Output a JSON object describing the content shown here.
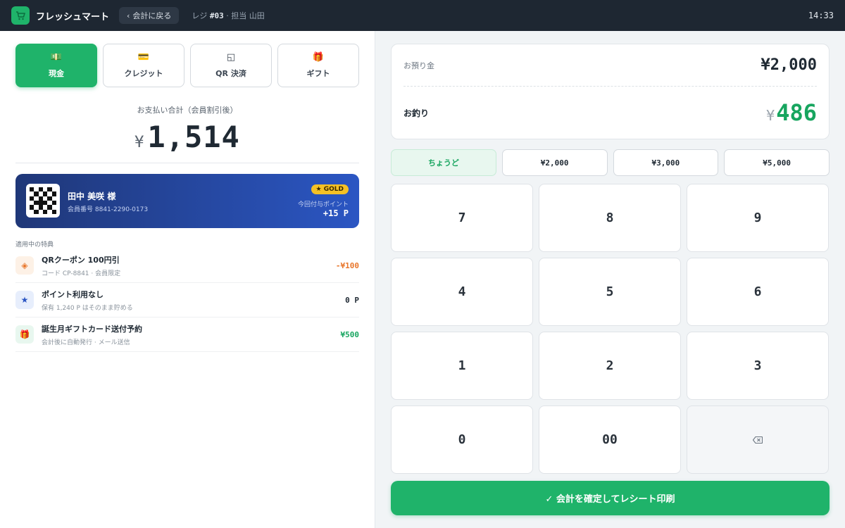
{
  "topbar": {
    "brand": "フレッシュマート",
    "back_label": "会計に戻る",
    "register_prefix": "レジ",
    "register_no": "#03",
    "staff": "· 担当 山田",
    "clock": "14:33"
  },
  "methods": [
    {
      "label": "現金",
      "icon": "cash-icon",
      "active": true
    },
    {
      "label": "クレジット",
      "icon": "credit-card-icon",
      "active": false
    },
    {
      "label": "QR 決済",
      "icon": "qr-icon",
      "active": false
    },
    {
      "label": "ギフト",
      "icon": "gift-icon",
      "active": false
    }
  ],
  "payment": {
    "total_label": "お支払い合計（会員割引後）",
    "currency": "¥",
    "total": "1,514"
  },
  "member": {
    "name": "田中 美咲 様",
    "number": "会員番号 8841-2290-0173",
    "badge": "★ GOLD",
    "points_label": "今回付与ポイント",
    "points": "+15 P"
  },
  "benefits": {
    "title": "適用中の特典",
    "items": [
      {
        "title": "QRクーポン 100円引",
        "sub": "コード CP-8841 · 会員限定",
        "value": "-¥100",
        "icon": "coupon-icon",
        "color": "#e8762b"
      },
      {
        "title": "ポイント利用なし",
        "sub": "保有 1,240 P はそのまま貯める",
        "value": "0 P",
        "icon": "star-icon",
        "color": "#1f2933"
      },
      {
        "title": "誕生月ギフトカード送付予約",
        "sub": "会計後に自動発行 · メール送信",
        "value": "¥500",
        "icon": "gift-icon",
        "color": "#17a55f"
      }
    ]
  },
  "tender": {
    "received_label": "お預り金",
    "received": "¥2,000",
    "change_label": "お釣り",
    "change_currency": "¥",
    "change": "486"
  },
  "quick_amounts": [
    "ちょうど",
    "¥2,000",
    "¥3,000",
    "¥5,000"
  ],
  "keys": [
    "7",
    "8",
    "9",
    "4",
    "5",
    "6",
    "1",
    "2",
    "3",
    "0",
    "00"
  ],
  "backspace_icon": "backspace-icon",
  "confirm_label": "✓ 会計を確定してレシート印刷",
  "colors": {
    "accent": "#1fb36a",
    "topbar": "#1e2732",
    "member_card": "#2b56c3",
    "gold": "#f5c125"
  }
}
